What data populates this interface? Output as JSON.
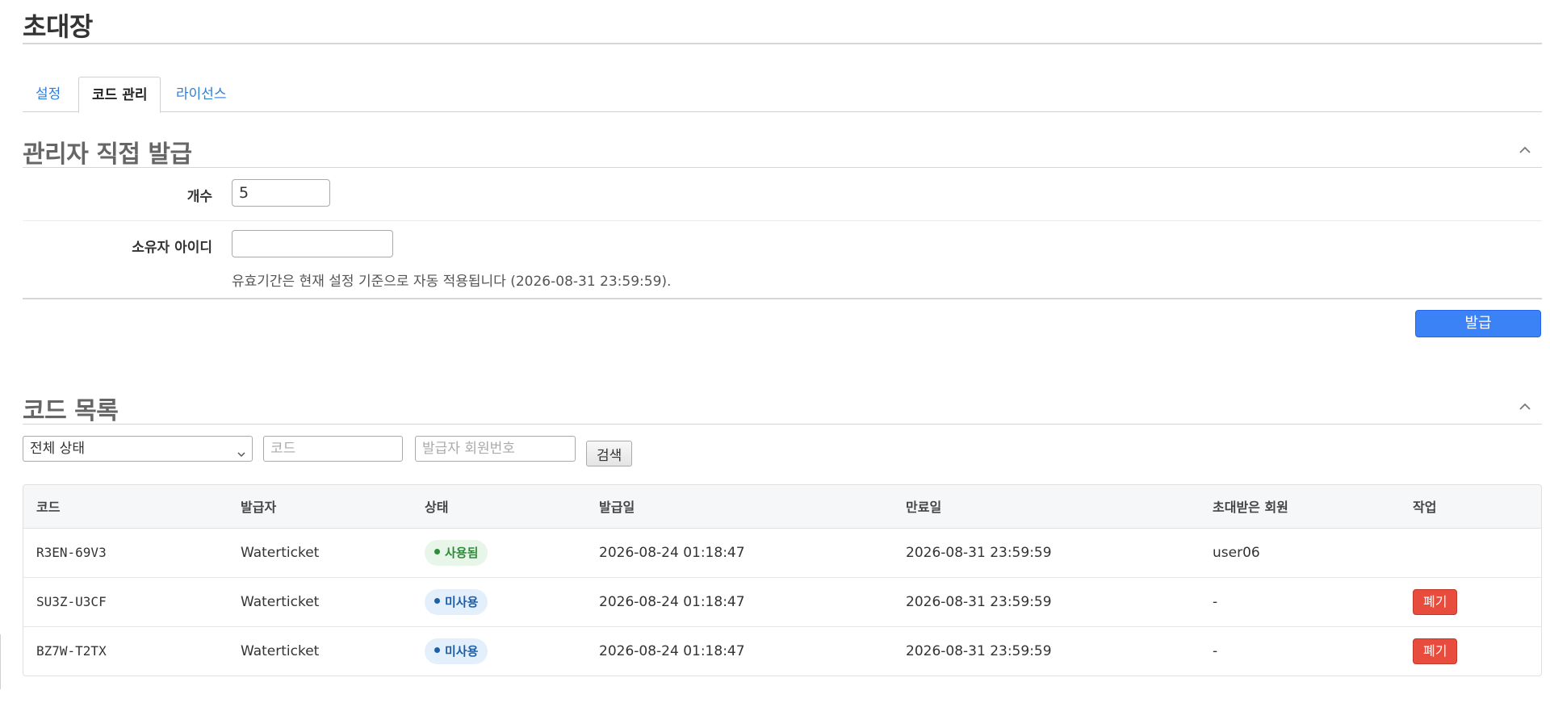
{
  "page": {
    "title": "초대장"
  },
  "tabs": [
    {
      "label": "설정",
      "active": false
    },
    {
      "label": "코드 관리",
      "active": true
    },
    {
      "label": "라이선스",
      "active": false
    }
  ],
  "issue_section": {
    "title": "관리자 직접 발급",
    "count_label": "개수",
    "count_value": "5",
    "owner_label": "소유자 아이디",
    "owner_value": "",
    "help_text": "유효기간은 현재 설정 기준으로 자동 적용됩니다 (2026-08-31 23:59:59).",
    "issue_button": "발급",
    "collapse_icon": "chevron-up-icon"
  },
  "list_section": {
    "title": "코드 목록",
    "collapse_icon": "chevron-up-icon",
    "filters": {
      "status_selected": "전체 상태",
      "code_placeholder": "코드",
      "issuer_placeholder": "발급자 회원번호",
      "search_button": "검색"
    },
    "table": {
      "headers": [
        "코드",
        "발급자",
        "상태",
        "발급일",
        "만료일",
        "초대받은 회원",
        "작업"
      ],
      "rows": [
        {
          "code": "R3EN-69V3",
          "issuer": "Waterticket",
          "status": "사용됨",
          "issued": "2026-08-24 01:18:47",
          "expires": "2026-08-31 23:59:59",
          "invited": "user06",
          "action": ""
        },
        {
          "code": "SU3Z-U3CF",
          "issuer": "Waterticket",
          "status": "미사용",
          "issued": "2026-08-24 01:18:47",
          "expires": "2026-08-31 23:59:59",
          "invited": "-",
          "action": "폐기"
        },
        {
          "code": "BZ7W-T2TX",
          "issuer": "Waterticket",
          "status": "미사용",
          "issued": "2026-08-24 01:18:47",
          "expires": "2026-08-31 23:59:59",
          "invited": "-",
          "action": "폐기"
        }
      ]
    }
  },
  "colors": {
    "accent": "#3b82f6",
    "link": "#2f7ed8",
    "danger": "#e84c3d",
    "status_used": "#2e8b3a",
    "status_unused": "#1e5fa8"
  }
}
